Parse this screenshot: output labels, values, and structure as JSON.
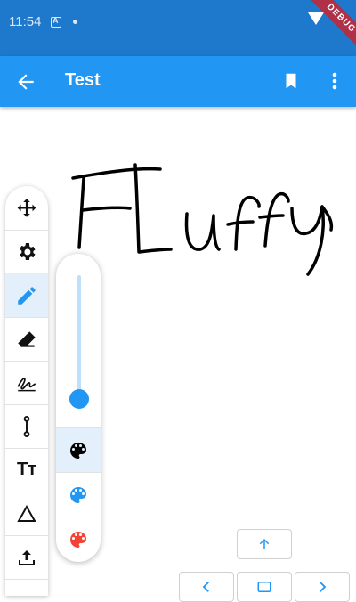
{
  "status_bar": {
    "time": "11:54",
    "debug_label": "DEBUG"
  },
  "app_bar": {
    "title": "Test"
  },
  "colors": {
    "status_bar": "#1e78cb",
    "app_bar": "#2196f3",
    "accent": "#2196f3",
    "selected_bg": "#e3f0fb",
    "palette_black": "#000000",
    "palette_blue": "#2196f3",
    "palette_red": "#f44336"
  },
  "toolbar": {
    "tools": [
      {
        "icon": "move-icon",
        "active": false
      },
      {
        "icon": "gear-icon",
        "active": false
      },
      {
        "icon": "pencil-icon",
        "active": true
      },
      {
        "icon": "eraser-icon",
        "active": false
      },
      {
        "icon": "signature-icon",
        "active": false
      },
      {
        "icon": "line-icon",
        "active": false
      },
      {
        "icon": "text-size-icon",
        "active": false
      },
      {
        "icon": "triangle-icon",
        "active": false
      },
      {
        "icon": "upload-icon",
        "active": false
      }
    ],
    "text_tool_label": "Tт"
  },
  "stroke_popup": {
    "stroke_width_level": 0.05,
    "palettes": [
      {
        "icon": "palette-icon",
        "color": "#000000",
        "active": true
      },
      {
        "icon": "palette-icon",
        "color": "#2196f3",
        "active": false
      },
      {
        "icon": "palette-icon",
        "color": "#f44336",
        "active": false
      }
    ]
  },
  "canvas": {
    "handwritten_text": "Fluffy"
  }
}
